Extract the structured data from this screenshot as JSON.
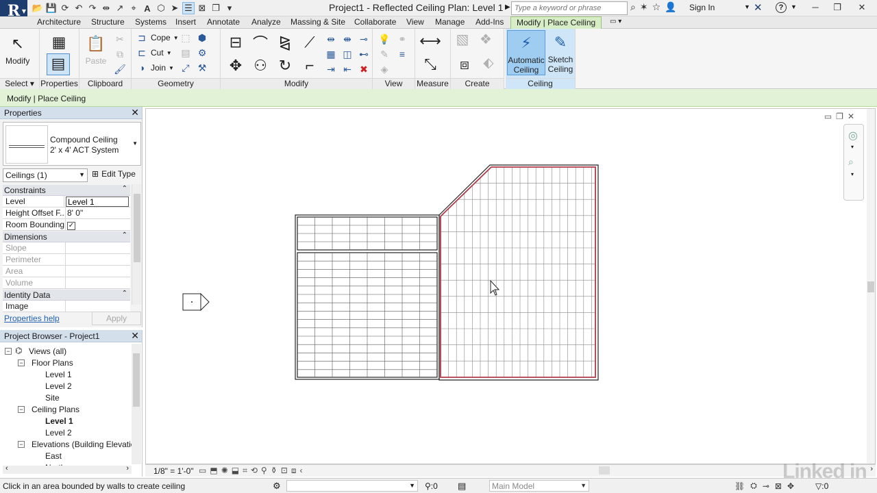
{
  "app": {
    "logo": "R",
    "title": "Project1 - Reflected Ceiling Plan: Level 1",
    "search_placeholder": "Type a keyword or phrase",
    "sign_in": "Sign In",
    "help": "?"
  },
  "ribbon_tabs": [
    "Architecture",
    "Structure",
    "Systems",
    "Insert",
    "Annotate",
    "Analyze",
    "Massing & Site",
    "Collaborate",
    "View",
    "Manage",
    "Add-Ins",
    "Modify | Place Ceiling"
  ],
  "ribbon": {
    "select": {
      "modify_label": "Modify",
      "panel": "Select"
    },
    "properties": {
      "panel": "Properties"
    },
    "clipboard": {
      "paste": "Paste",
      "panel": "Clipboard"
    },
    "geometry": {
      "cope": "Cope",
      "cut": "Cut",
      "join": "Join",
      "panel": "Geometry"
    },
    "modify": {
      "panel": "Modify"
    },
    "view": {
      "panel": "View"
    },
    "measure": {
      "panel": "Measure"
    },
    "create": {
      "panel": "Create"
    },
    "ceiling": {
      "auto_l1": "Automatic",
      "auto_l2": "Ceiling",
      "sketch_l1": "Sketch",
      "sketch_l2": "Ceiling",
      "panel": "Ceiling"
    }
  },
  "context_bar": "Modify | Place Ceiling",
  "properties": {
    "title": "Properties",
    "type_line1": "Compound Ceiling",
    "type_line2": "2' x 4' ACT System",
    "instance_filter": "Ceilings (1)",
    "edit_type": "Edit Type",
    "groups": {
      "constraints": "Constraints",
      "dimensions": "Dimensions",
      "identity": "Identity Data"
    },
    "rows": {
      "level_k": "Level",
      "level_v": "Level 1",
      "height_k": "Height Offset F...",
      "height_v": "8'  0\"",
      "room_k": "Room Bounding",
      "slope_k": "Slope",
      "perimeter_k": "Perimeter",
      "area_k": "Area",
      "volume_k": "Volume",
      "image_k": "Image"
    },
    "help": "Properties help",
    "apply": "Apply"
  },
  "browser": {
    "title": "Project Browser - Project1",
    "items": [
      {
        "label": "Views (all)"
      },
      {
        "label": "Floor Plans"
      },
      {
        "label": "Level 1"
      },
      {
        "label": "Level 2"
      },
      {
        "label": "Site"
      },
      {
        "label": "Ceiling Plans"
      },
      {
        "label": "Level 1"
      },
      {
        "label": "Level 2"
      },
      {
        "label": "Elevations (Building Elevation"
      },
      {
        "label": "East"
      },
      {
        "label": "North"
      }
    ]
  },
  "view_bar": {
    "scale": "1/8\" = 1'-0\""
  },
  "status": {
    "message": "Click in an area bounded by walls to create ceiling",
    "count": ":0",
    "model": "Main Model",
    "filter": ":0"
  },
  "watermark": "Linked in",
  "colors": {
    "ceiling_boundary": "#b03a48",
    "context_green": "#e2f2d6",
    "ceiling_panel_blue": "#cfe6f8"
  }
}
